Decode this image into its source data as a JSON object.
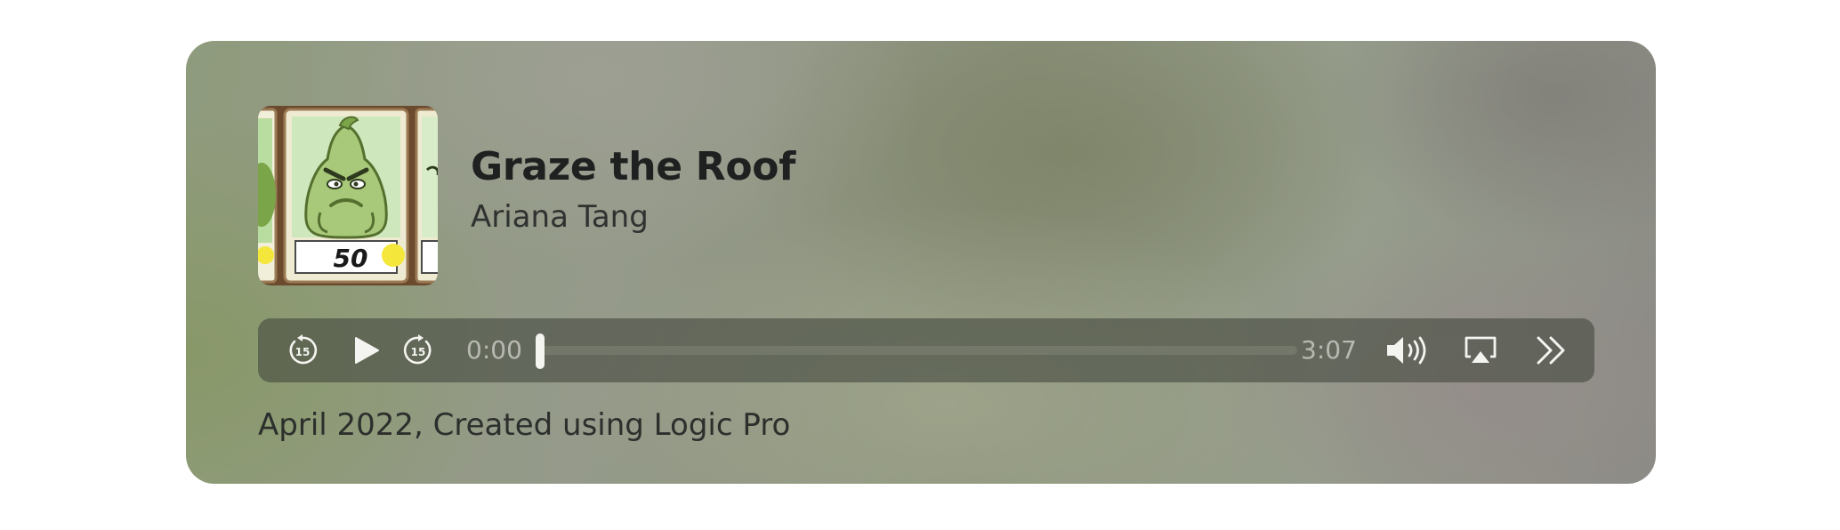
{
  "track": {
    "title": "Graze the Roof",
    "artist": "Ariana Tang",
    "description": "April 2022, Created using Logic Pro",
    "artwork": {
      "card_cost": "50",
      "icon": "squash-plant-seed-packet-artwork"
    }
  },
  "player": {
    "current_time": "0:00",
    "duration": "3:07",
    "progress_fraction": 0,
    "skip_seconds": "15",
    "icons": {
      "skip_back": "rewind-15-icon",
      "play": "play-icon",
      "skip_forward": "forward-15-icon",
      "volume": "speaker-volume-icon",
      "airplay": "airplay-icon",
      "more": "double-chevron-right-icon"
    }
  },
  "colors": {
    "controls_bar": "#4a5040",
    "icon_fill": "#f4f4f0",
    "title_text": "#1f2020"
  }
}
